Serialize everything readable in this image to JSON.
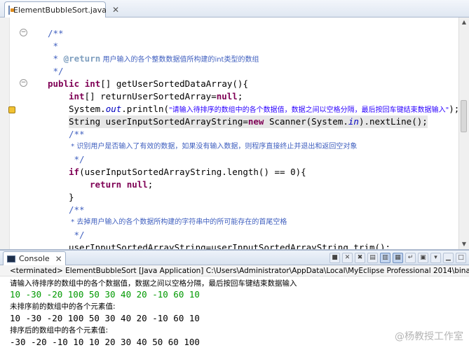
{
  "editor": {
    "tab_label": "ElementBubbleSort.java",
    "tab_close": "✕",
    "lines": {
      "l1": "/**",
      "l2": " *",
      "l3_tag": "@return",
      "l3_text": " 用户输入的各个整数数据值所构建的int类型的数组",
      "l4": " */",
      "l5_kw1": "public",
      "l5_kw2": "int",
      "l5_rest": "[] getUserSortedDataArray(){",
      "l6_kw": "int",
      "l6_rest": "[] returnUserSortedArray=",
      "l6_null": "null",
      "l6_end": ";",
      "l7_pre": "System.",
      "l7_fld": "out",
      "l7_mid": ".println(",
      "l7_str": "\"请输入待排序的数组中的各个数据值，数据之间以空格分隔，最后按回车键结束数据输入\"",
      "l7_end": ");",
      "l8_pre": "String userInputSortedArrayString=",
      "l8_new": "new",
      "l8_mid": " Scanner(System.",
      "l8_fld": "in",
      "l8_end": ").nextLine();",
      "l9": "/**",
      "l10": " * 识别用户是否输入了有效的数据，如果没有输入数据，则程序直接终止并退出和返回空对象",
      "l11": " */",
      "l12_kw": "if",
      "l12_rest": "(userInputSortedArrayString.length() == 0){",
      "l13_kw": "return",
      "l13_null": "null",
      "l13_end": ";",
      "l14": "}",
      "l15": "/**",
      "l16": " * 去掉用户输入的各个数据所构建的字符串中的所可能存在的首尾空格",
      "l17": " */",
      "l18": "userInputSortedArrayString=userInputSortedArrayString.trim();",
      "l19": "/**"
    }
  },
  "console": {
    "tab_label": "Console",
    "tab_close": "✕",
    "terminated": "<terminated> ElementBubbleSort [Java Application] C:\\Users\\Administrator\\AppData\\Local\\MyEclipse Professional 2014\\binary\\com.sun.j",
    "output": [
      "请输入待排序的数组中的各个数据值，数据之间以空格分隔，最后按回车键结束数据输入",
      "10 -30 -20 100 50 30 40 20 -10 60 10",
      "未排序前的数组中的各个元素值:",
      "10 -30 -20 100 50 30 40 20 -10 60 10",
      "排序后的数组中的各个元素值:",
      "-30 -20 -10 10 10 20 30 40 50 60 100"
    ],
    "toolbar_icons": [
      "stop-icon",
      "remove-launch-icon",
      "remove-all-icon",
      "clear-console-icon",
      "scroll-lock-icon",
      "pin-console-icon",
      "word-wrap-icon",
      "display-console-icon",
      "open-console-icon",
      "minimize-icon",
      "maximize-icon"
    ]
  },
  "watermark": "@杨教授工作室",
  "colors": {
    "keyword": "#7f0055",
    "comment": "#3f5fbf",
    "string": "#2a00ff",
    "field": "#0000c0",
    "user_input": "#009900"
  }
}
